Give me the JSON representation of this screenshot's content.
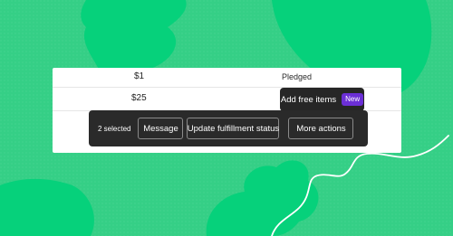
{
  "colors": {
    "background": "#33d186",
    "shape": "#05d07a",
    "accent_badge": "#6b2fd6",
    "toolbar_bg": "#2a2a2a"
  },
  "table": {
    "rows": [
      {
        "amount": "$1",
        "status": "Pledged"
      },
      {
        "amount": "$25",
        "status": ""
      }
    ]
  },
  "tooltip": {
    "label": "Add free items",
    "badge": "New"
  },
  "action_bar": {
    "selected_count": "2 selected",
    "buttons": {
      "message": "Message",
      "update_fulfillment": "Update fulfillment status",
      "more_actions": "More actions"
    }
  }
}
